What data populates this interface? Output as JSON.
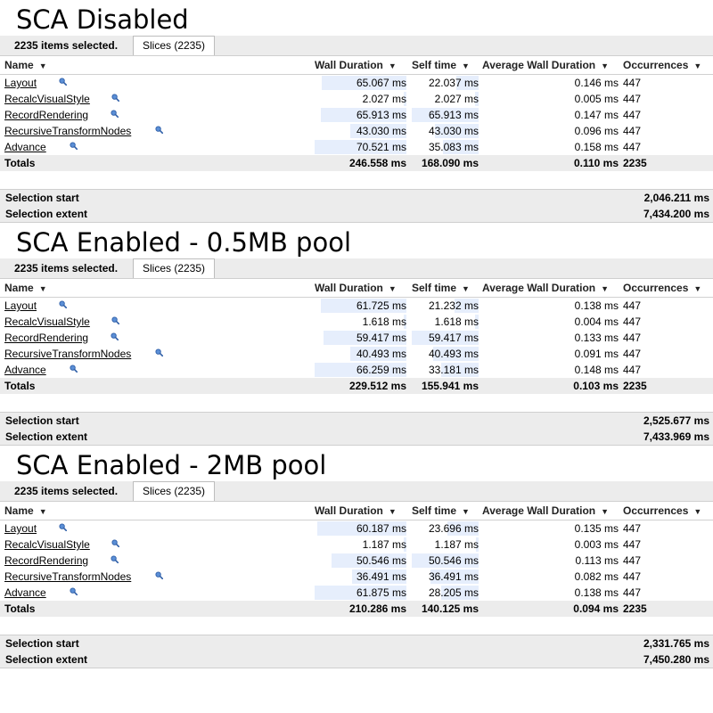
{
  "columns": {
    "name": "Name",
    "wall": "Wall Duration",
    "self": "Self time",
    "avg": "Average Wall Duration",
    "occ": "Occurrences",
    "sort_icon": "▼"
  },
  "labels": {
    "totals": "Totals",
    "selection_start": "Selection start",
    "selection_extent": "Selection extent"
  },
  "panels": [
    {
      "title": "SCA Disabled",
      "selected_text": "2235 items selected.",
      "tab_label": "Slices (2235)",
      "rows": [
        {
          "name": "Layout",
          "wall": "65.067 ms",
          "self": "22.037 ms",
          "avg": "0.146 ms",
          "occ": "447",
          "wall_frac": 0.92,
          "self_frac": 0.34
        },
        {
          "name": "RecalcVisualStyle",
          "wall": "2.027 ms",
          "self": "2.027 ms",
          "avg": "0.005 ms",
          "occ": "447",
          "wall_frac": 0.03,
          "self_frac": 0.05
        },
        {
          "name": "RecordRendering",
          "wall": "65.913 ms",
          "self": "65.913 ms",
          "avg": "0.147 ms",
          "occ": "447",
          "wall_frac": 0.93,
          "self_frac": 1.0
        },
        {
          "name": "RecursiveTransformNodes",
          "wall": "43.030 ms",
          "self": "43.030 ms",
          "avg": "0.096 ms",
          "occ": "447",
          "wall_frac": 0.61,
          "self_frac": 0.65
        },
        {
          "name": "Advance",
          "wall": "70.521 ms",
          "self": "35.083 ms",
          "avg": "0.158 ms",
          "occ": "447",
          "wall_frac": 1.0,
          "self_frac": 0.53
        }
      ],
      "totals": {
        "wall": "246.558 ms",
        "self": "168.090 ms",
        "avg": "0.110 ms",
        "occ": "2235"
      },
      "selection_start": "2,046.211 ms",
      "selection_extent": "7,434.200 ms"
    },
    {
      "title": "SCA Enabled - 0.5MB pool",
      "selected_text": "2235 items selected.",
      "tab_label": "Slices (2235)",
      "rows": [
        {
          "name": "Layout",
          "wall": "61.725 ms",
          "self": "21.232 ms",
          "avg": "0.138 ms",
          "occ": "447",
          "wall_frac": 0.93,
          "self_frac": 0.36
        },
        {
          "name": "RecalcVisualStyle",
          "wall": "1.618 ms",
          "self": "1.618 ms",
          "avg": "0.004 ms",
          "occ": "447",
          "wall_frac": 0.03,
          "self_frac": 0.05
        },
        {
          "name": "RecordRendering",
          "wall": "59.417 ms",
          "self": "59.417 ms",
          "avg": "0.133 ms",
          "occ": "447",
          "wall_frac": 0.9,
          "self_frac": 1.0
        },
        {
          "name": "RecursiveTransformNodes",
          "wall": "40.493 ms",
          "self": "40.493 ms",
          "avg": "0.091 ms",
          "occ": "447",
          "wall_frac": 0.61,
          "self_frac": 0.68
        },
        {
          "name": "Advance",
          "wall": "66.259 ms",
          "self": "33.181 ms",
          "avg": "0.148 ms",
          "occ": "447",
          "wall_frac": 1.0,
          "self_frac": 0.56
        }
      ],
      "totals": {
        "wall": "229.512 ms",
        "self": "155.941 ms",
        "avg": "0.103 ms",
        "occ": "2235"
      },
      "selection_start": "2,525.677 ms",
      "selection_extent": "7,433.969 ms"
    },
    {
      "title": "SCA Enabled - 2MB pool",
      "selected_text": "2235 items selected.",
      "tab_label": "Slices (2235)",
      "rows": [
        {
          "name": "Layout",
          "wall": "60.187 ms",
          "self": "23.696 ms",
          "avg": "0.135 ms",
          "occ": "447",
          "wall_frac": 0.97,
          "self_frac": 0.47
        },
        {
          "name": "RecalcVisualStyle",
          "wall": "1.187 ms",
          "self": "1.187 ms",
          "avg": "0.003 ms",
          "occ": "447",
          "wall_frac": 0.03,
          "self_frac": 0.04
        },
        {
          "name": "RecordRendering",
          "wall": "50.546 ms",
          "self": "50.546 ms",
          "avg": "0.113 ms",
          "occ": "447",
          "wall_frac": 0.82,
          "self_frac": 1.0
        },
        {
          "name": "RecursiveTransformNodes",
          "wall": "36.491 ms",
          "self": "36.491 ms",
          "avg": "0.082 ms",
          "occ": "447",
          "wall_frac": 0.59,
          "self_frac": 0.72
        },
        {
          "name": "Advance",
          "wall": "61.875 ms",
          "self": "28.205 ms",
          "avg": "0.138 ms",
          "occ": "447",
          "wall_frac": 1.0,
          "self_frac": 0.56
        }
      ],
      "totals": {
        "wall": "210.286 ms",
        "self": "140.125 ms",
        "avg": "0.094 ms",
        "occ": "2235"
      },
      "selection_start": "2,331.765 ms",
      "selection_extent": "7,450.280 ms"
    }
  ]
}
